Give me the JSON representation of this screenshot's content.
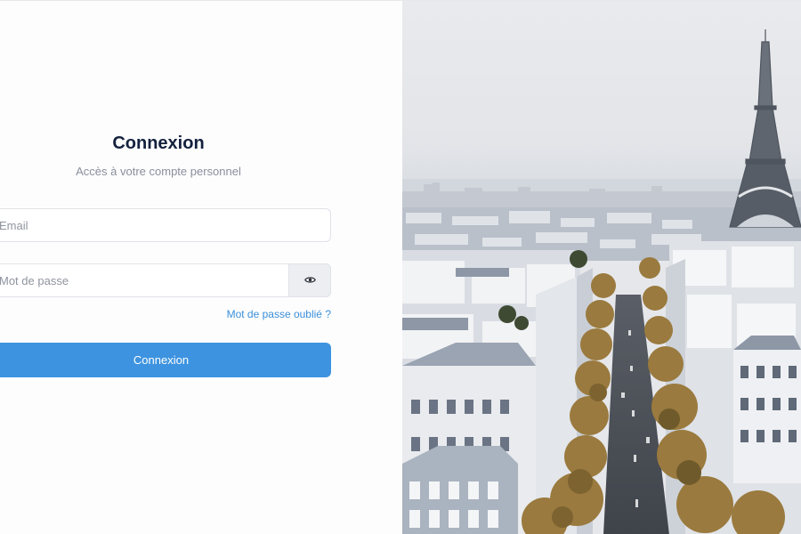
{
  "login": {
    "title": "Connexion",
    "subtitle": "Accès à votre compte personnel",
    "email_placeholder": "Email",
    "password_placeholder": "Mot de passe",
    "forgot_password": "Mot de passe oublié ?",
    "submit_label": "Connexion"
  },
  "icons": {
    "password_toggle": "eye-icon"
  },
  "colors": {
    "accent": "#3d93e0",
    "link": "#3a8fd8",
    "title": "#14213d",
    "muted": "#8a8f9c"
  },
  "hero_image": {
    "subject": "aerial view of Paris with the Eiffel Tower"
  }
}
